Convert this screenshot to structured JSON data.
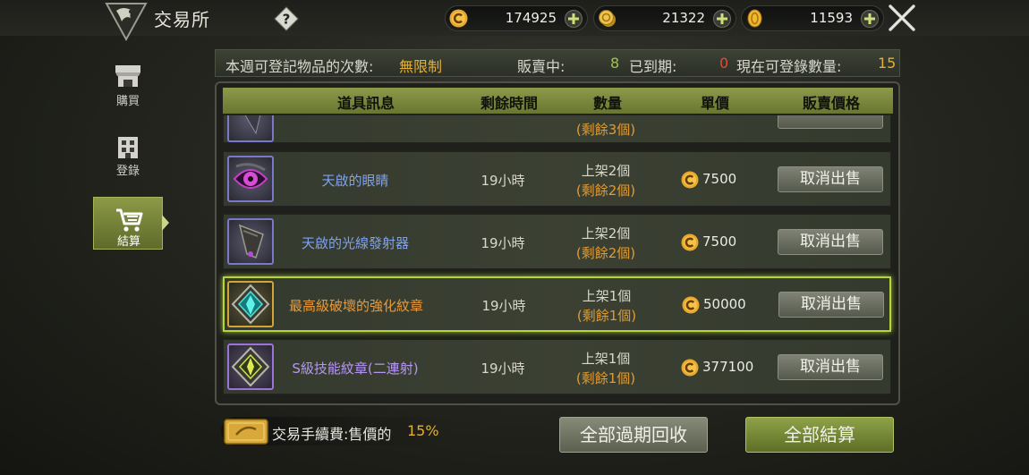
{
  "header": {
    "title": "交易所",
    "currencies": [
      {
        "icon": "c-coin-icon",
        "value": "174925"
      },
      {
        "icon": "gold-coin-stack-icon",
        "value": "21322"
      },
      {
        "icon": "gold-coin-icon",
        "value": "11593"
      }
    ]
  },
  "sidebar": {
    "items": [
      {
        "label": "購買",
        "icon": "shop-icon",
        "active": false
      },
      {
        "label": "登錄",
        "icon": "building-icon",
        "active": false
      },
      {
        "label": "結算",
        "icon": "cart-icon",
        "active": true
      }
    ]
  },
  "info": {
    "weekly_label": "本週可登記物品的次數:",
    "weekly_value": "無限制",
    "selling_label": "販賣中:",
    "selling_value": "8",
    "expired_label": "已到期:",
    "expired_value": "0",
    "available_label": "現在可登錄數量:",
    "available_value": "15"
  },
  "table": {
    "columns": [
      "道具訊息",
      "剩餘時間",
      "數量",
      "單價",
      "販賣價格"
    ],
    "partial_row_remaining": "(剩餘3個)",
    "rows": [
      {
        "name": "天啟的眼睛",
        "name_color": "#7ea2f0",
        "time": "19小時",
        "listed": "上架2個",
        "remaining": "(剩餘2個)",
        "price": "7500",
        "button": "取消出售",
        "selected": false
      },
      {
        "name": "天啟的光線發射器",
        "name_color": "#7ea2f0",
        "time": "19小時",
        "listed": "上架2個",
        "remaining": "(剩餘2個)",
        "price": "7500",
        "button": "取消出售",
        "selected": false
      },
      {
        "name": "最高級破壞的強化紋章",
        "name_color": "#e79a3a",
        "time": "19小時",
        "listed": "上架1個",
        "remaining": "(剩餘1個)",
        "price": "50000",
        "button": "取消出售",
        "selected": true
      },
      {
        "name": "S級技能紋章(二連射)",
        "name_color": "#b597f0",
        "time": "19小時",
        "listed": "上架1個",
        "remaining": "(剩餘1個)",
        "price": "377100",
        "button": "取消出售",
        "selected": false
      }
    ]
  },
  "footer": {
    "fee_label": "交易手續費:售價的",
    "fee_value": "15%",
    "reclaim_button": "全部過期回收",
    "settle_button": "全部結算"
  },
  "colors": {
    "accent_green": "#8c9a47",
    "highlight_yellow": "#e5b032",
    "alert_red": "#e04b3a",
    "selected_border": "#b6d43e"
  }
}
